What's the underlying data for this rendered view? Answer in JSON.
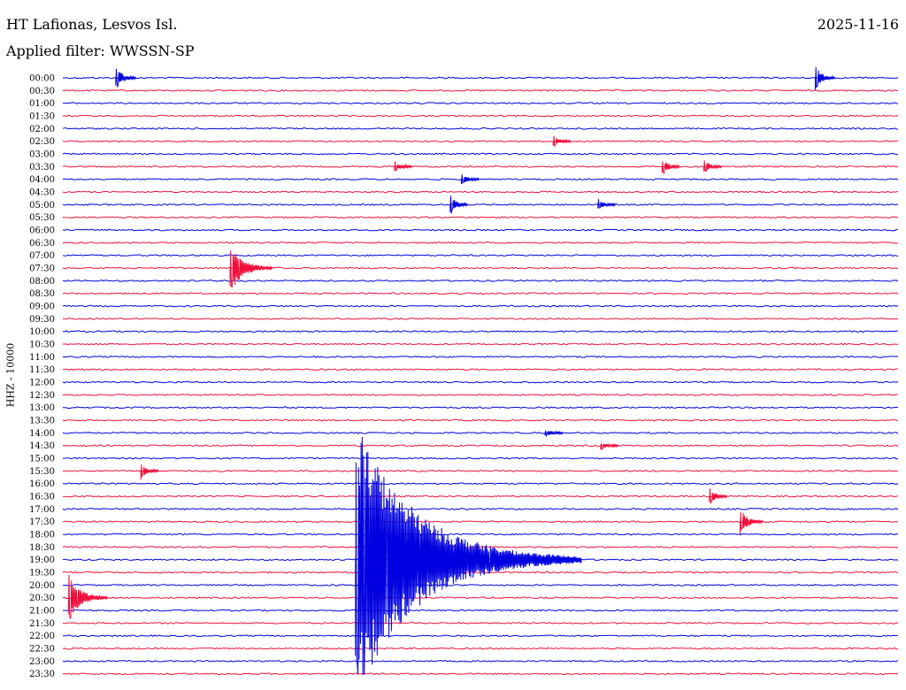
{
  "header": {
    "station": "HT Lafionas, Lesvos Isl.",
    "date": "2025-11-16",
    "filter_label": "Applied filter:",
    "filter_name": "WWSSN-SP"
  },
  "channel_label": "HHZ - 10000",
  "colors": {
    "odd_rows": "#0000e0",
    "even_rows": "#f0103c",
    "background": "#ffffff"
  },
  "chart_data": {
    "type": "line",
    "subtype": "helicorder",
    "time_labels": [
      "00:00",
      "00:30",
      "01:00",
      "01:30",
      "02:00",
      "02:30",
      "03:00",
      "03:30",
      "04:00",
      "04:30",
      "05:00",
      "05:30",
      "06:00",
      "06:30",
      "07:00",
      "07:30",
      "08:00",
      "08:30",
      "09:00",
      "09:30",
      "10:00",
      "10:30",
      "11:00",
      "11:30",
      "12:00",
      "12:30",
      "13:00",
      "13:30",
      "14:00",
      "14:30",
      "15:00",
      "15:30",
      "16:00",
      "16:30",
      "17:00",
      "17:30",
      "18:00",
      "18:30",
      "19:00",
      "19:30",
      "20:00",
      "20:30",
      "21:00",
      "21:30",
      "22:00",
      "22:30",
      "23:00",
      "23:30"
    ],
    "row_duration_minutes": 30,
    "events": [
      {
        "row": 0,
        "minute": 1.9,
        "amplitude": 14
      },
      {
        "row": 0,
        "minute": 27.0,
        "amplitude": 14
      },
      {
        "row": 5,
        "minute": 17.6,
        "amplitude": 6
      },
      {
        "row": 7,
        "minute": 11.9,
        "amplitude": 6
      },
      {
        "row": 7,
        "minute": 21.5,
        "amplitude": 10
      },
      {
        "row": 7,
        "minute": 23.0,
        "amplitude": 8
      },
      {
        "row": 8,
        "minute": 14.3,
        "amplitude": 6
      },
      {
        "row": 10,
        "minute": 13.9,
        "amplitude": 12
      },
      {
        "row": 10,
        "minute": 19.2,
        "amplitude": 6
      },
      {
        "row": 15,
        "minute": 6.0,
        "amplitude": 30
      },
      {
        "row": 28,
        "minute": 17.3,
        "amplitude": 3
      },
      {
        "row": 29,
        "minute": 19.3,
        "amplitude": 4
      },
      {
        "row": 31,
        "minute": 2.8,
        "amplitude": 9
      },
      {
        "row": 33,
        "minute": 23.2,
        "amplitude": 10
      },
      {
        "row": 35,
        "minute": 24.3,
        "amplitude": 16
      },
      {
        "row": 38,
        "minute": 10.5,
        "amplitude": 160
      },
      {
        "row": 41,
        "minute": 0.2,
        "amplitude": 28
      }
    ]
  }
}
